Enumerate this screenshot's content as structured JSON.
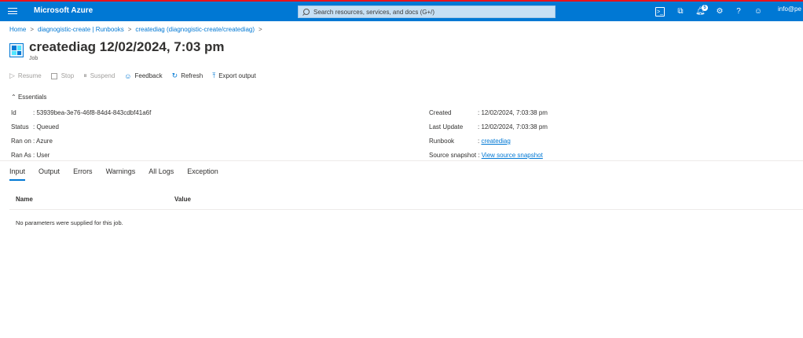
{
  "topbar": {
    "brand": "Microsoft Azure",
    "search_placeholder": "Search resources, services, and docs (G+/)",
    "notification_count": "5",
    "account": "info@pe"
  },
  "breadcrumb": {
    "items": [
      "Home",
      "diagnogistic-create | Runbooks",
      "creatediag (diagnogistic-create/creatediag)"
    ],
    "separator": ">"
  },
  "header": {
    "title": "creatediag 12/02/2024, 7:03 pm",
    "more": "···",
    "subtitle": "Job"
  },
  "toolbar": {
    "resume": "Resume",
    "stop": "Stop",
    "suspend": "Suspend",
    "feedback": "Feedback",
    "refresh": "Refresh",
    "export": "Export output"
  },
  "essentials": {
    "label": "Essentials",
    "left": [
      {
        "key": "Id",
        "value": "53939bea-3e76-46f8-84d4-843cdbf41a6f"
      },
      {
        "key": "Status",
        "value": "Queued"
      },
      {
        "key": "Ran on",
        "value": "Azure"
      },
      {
        "key": "Ran As",
        "value": "User"
      }
    ],
    "right": [
      {
        "key": "Created",
        "value": "12/02/2024, 7:03:38 pm"
      },
      {
        "key": "Last Update",
        "value": "12/02/2024, 7:03:38 pm"
      },
      {
        "key": "Runbook",
        "value": "creatediag"
      },
      {
        "key": "Source snapshot",
        "value": "View source snapshot"
      }
    ]
  },
  "tabs": [
    "Input",
    "Output",
    "Errors",
    "Warnings",
    "All Logs",
    "Exception"
  ],
  "table": {
    "columns": [
      "Name",
      "Value"
    ],
    "empty_message": "No parameters were supplied for this job."
  }
}
